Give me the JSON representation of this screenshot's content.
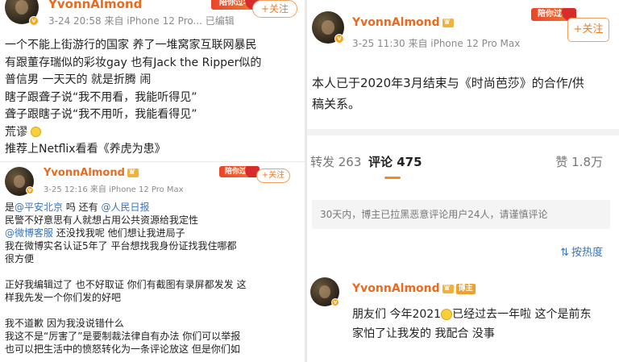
{
  "colors": {
    "accent": "#ef7b22",
    "username": "#e86b1f",
    "link": "#3a73b8",
    "tab_underline": "#f28a1e"
  },
  "post1": {
    "username": "YvonnAlmond",
    "meta": "3-24 20:58  来自 iPhone 12 Pro...  已编辑",
    "follow_label": "+关注",
    "sticker": "陪你过年",
    "lines": [
      "一个不能上街游行的国家 养了一堆窝家互联网暴民",
      "有跟董存瑞似的彩妆gay 也有Jack the Ripper似的",
      "普信男 一天天的 就是折腾 闹",
      "瞎子跟聋子说“我不用看，我能听得见”",
      "聋子跟瞎子说“我不用听，我能看得见”",
      "荒谬",
      "推荐上Netflix看看《养虎为患》"
    ]
  },
  "post2": {
    "username": "YvonnAlmond",
    "meta": "3-25 12:16  来自 iPhone 12 Pro Max",
    "follow_label": "+关注",
    "sticker": "陪你过年",
    "line1_prefix": "是",
    "mention1": "@平安北京",
    "line1_mid": " 吗 还有 ",
    "mention2": "@人民日报",
    "line2": "民警不好意思有人就想占用公共资源给我定性",
    "mention3": "@微博客服",
    "line3_rest": " 还没找我呢 他们想让我进局子",
    "line4": "我在微博实名认证5年了 平台想找我身份证找我住哪都",
    "line5": "很方便",
    "line6": "正好我编辑过了 也不好取证 你们有截图有录屏都发发 这",
    "line7": "样我先发一个你们发的好吧",
    "line8": "我不道歉 因为我没说错什么",
    "line9": "我这不是“厉害了”是要制裁法律自有办法 你们可以举报",
    "line10": "也可以把生活中的愤怒转化为一条评论放这 但是你们如"
  },
  "post3": {
    "username": "YvonnAlmond",
    "meta": "3-25 11:30  来自 iPhone 12 Pro Max",
    "follow_label": "+关注",
    "sticker": "陪你过年",
    "line1": "本人已于2020年3月结束与《时尚芭莎》的合作/供",
    "line2": "稿关系。",
    "tabs": {
      "repost": "转发 263",
      "comment": "评论 475",
      "like": "赞 1.8万"
    },
    "notice": "30天内，博主已拉黑恶意评论用户24人，请谨慎评论",
    "sort_label": "按热度",
    "comment": {
      "username": "YvonnAlmond",
      "badge": "博主",
      "line1_prefix": "朋友们 今年2021",
      "line1_suffix": "已经过去一年啦 这个是前东",
      "line2": "家怕了让我发的 我配合 没事"
    }
  }
}
